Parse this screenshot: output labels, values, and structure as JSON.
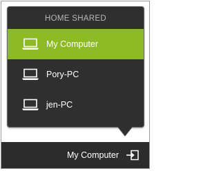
{
  "popup": {
    "header": "HOME SHARED",
    "items": [
      {
        "label": "My Computer",
        "icon": "laptop-icon",
        "selected": true
      },
      {
        "label": "Pory-PC",
        "icon": "laptop-icon",
        "selected": false
      },
      {
        "label": "jen-PC",
        "icon": "laptop-icon",
        "selected": false
      }
    ]
  },
  "status_bar": {
    "current_source": "My Computer",
    "switch_icon": "switch-source-icon"
  },
  "colors": {
    "accent": "#8cbb24",
    "panel": "#2f2f2f",
    "header_text": "#b8b8b8"
  }
}
